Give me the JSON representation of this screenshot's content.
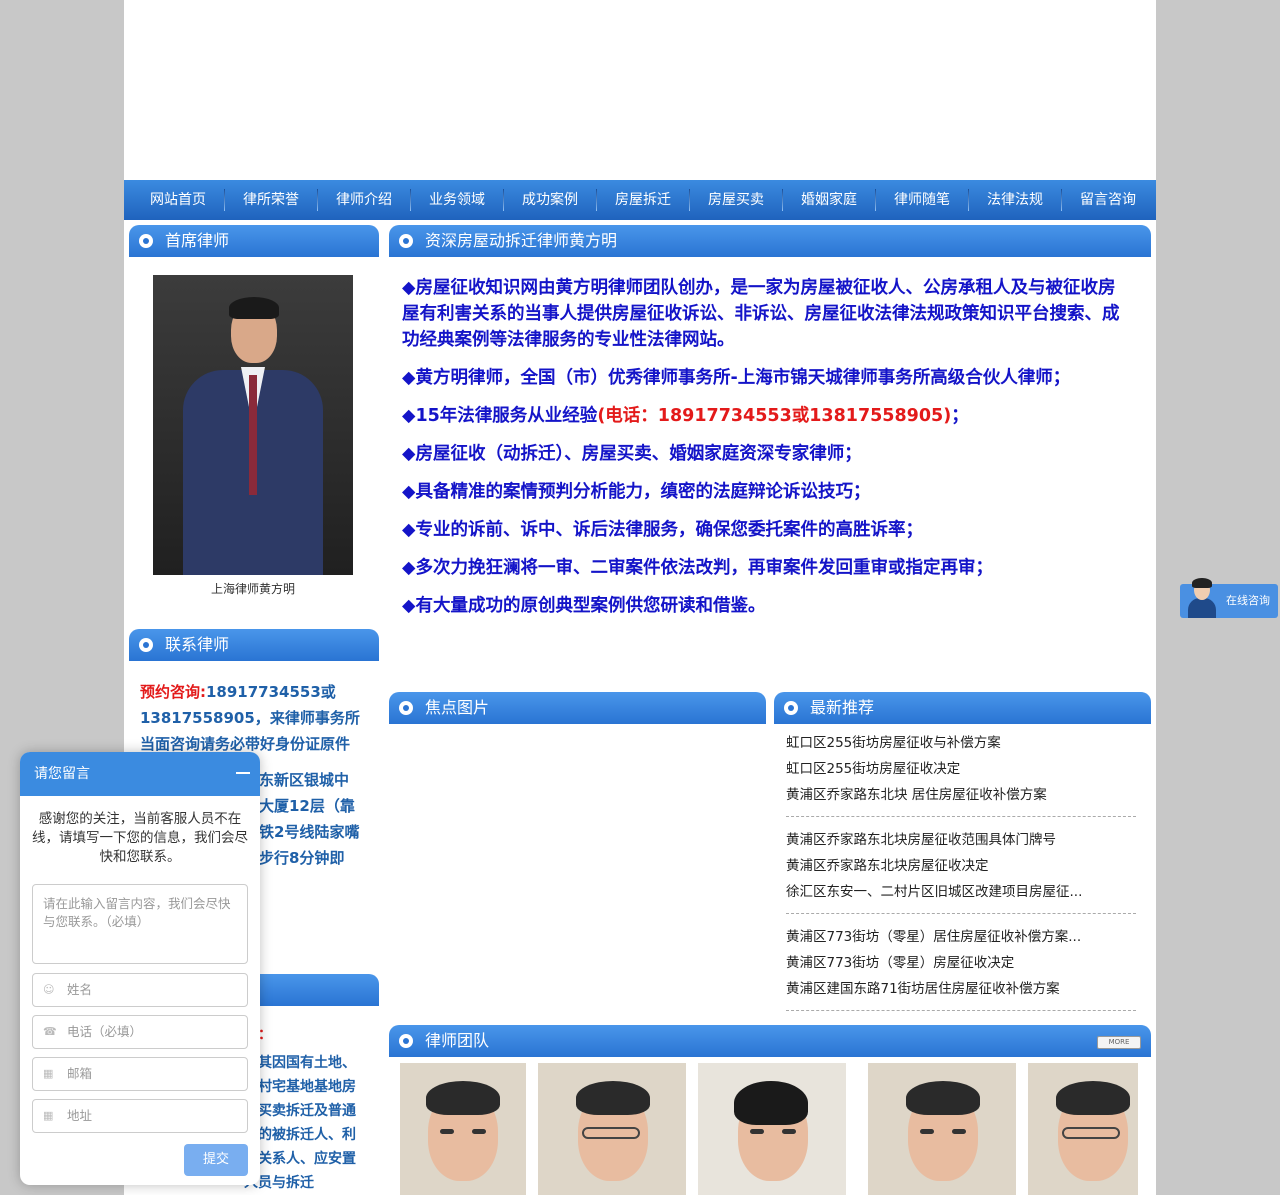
{
  "nav": {
    "items": [
      "网站首页",
      "律所荣誉",
      "律师介绍",
      "业务领域",
      "成功案例",
      "房屋拆迁",
      "房屋买卖",
      "婚姻家庭",
      "律师随笔",
      "法律法规",
      "留言咨询"
    ]
  },
  "left": {
    "head1": "首席律师",
    "caption": "上海律师黄方明",
    "head2": "联系律师",
    "contact_label": "预约咨询:",
    "contact_phone": "18917734553或13817558905，",
    "contact_text": "来律师事务所当面咨询请务必带好身份证原件",
    "address": "浦东新区银城中心大厦12层（靠地铁2号线陆家嘴站步行8分钟即",
    "head3": "",
    "lit_label": "讼：",
    "lit_text": "理其因国有土地、农村宅基地基地房屋买卖拆迁及普通商的被拆迁人、利害关系人、应安置人员与拆迁"
  },
  "main": {
    "head": "资深房屋动拆迁律师黄方明",
    "intro": {
      "p1": "◆房屋征收知识网由黄方明律师团队创办，是一家为房屋被征收人、公房承租人及与被征收房屋有利害关系的当事人提供房屋征收诉讼、非诉讼、房屋征收法律法规政策知识平台搜索、成功经典案例等法律服务的专业性法律网站。",
      "p2": "◆黄方明律师，全国（市）优秀律师事务所-上海市锦天城律师事务所高级合伙人律师；",
      "p3a": "◆15年法律服务从业经验",
      "p3b": "(电话：18917734553或13817558905)",
      "p3c": "；",
      "p4": "◆房屋征收（动拆迁）、房屋买卖、婚姻家庭资深专家律师；",
      "p5": "◆具备精准的案情预判分析能力，缜密的法庭辩论诉讼技巧；",
      "p6": "◆专业的诉前、诉中、诉后法律服务，确保您委托案件的高胜诉率；",
      "p7": "◆多次力挽狂澜将一审、二审案件依法改判，再审案件发回重审或指定再审；",
      "p8": "◆有大量成功的原创典型案例供您研读和借鉴。"
    },
    "focus_head": "焦点图片",
    "news_head": "最新推荐",
    "news": [
      [
        "虹口区255街坊房屋征收与补偿方案",
        "虹口区255街坊房屋征收决定",
        "黄浦区乔家路东北块 居住房屋征收补偿方案"
      ],
      [
        "黄浦区乔家路东北块房屋征收范围具体门牌号",
        "黄浦区乔家路东北块房屋征收决定",
        "徐汇区东安一、二村片区旧城区改建项目房屋征..."
      ],
      [
        "黄浦区773街坊（零星）居住房屋征收补偿方案...",
        "黄浦区773街坊（零星）房屋征收决定",
        "黄浦区建国东路71街坊居住房屋征收补偿方案"
      ]
    ],
    "team_head": "律师团队",
    "more": "MORE"
  },
  "chat": {
    "title": "请您留言",
    "message": "感谢您的关注，当前客服人员不在线，请填写一下您的信息，我们会尽快和您联系。",
    "textarea_placeholder": "请在此输入留言内容，我们会尽快与您联系。（必填）",
    "name_placeholder": "姓名",
    "phone_placeholder": "电话（必填）",
    "email_placeholder": "邮箱",
    "address_placeholder": "地址",
    "submit": "提交"
  },
  "online": {
    "label": "在线咨询"
  }
}
